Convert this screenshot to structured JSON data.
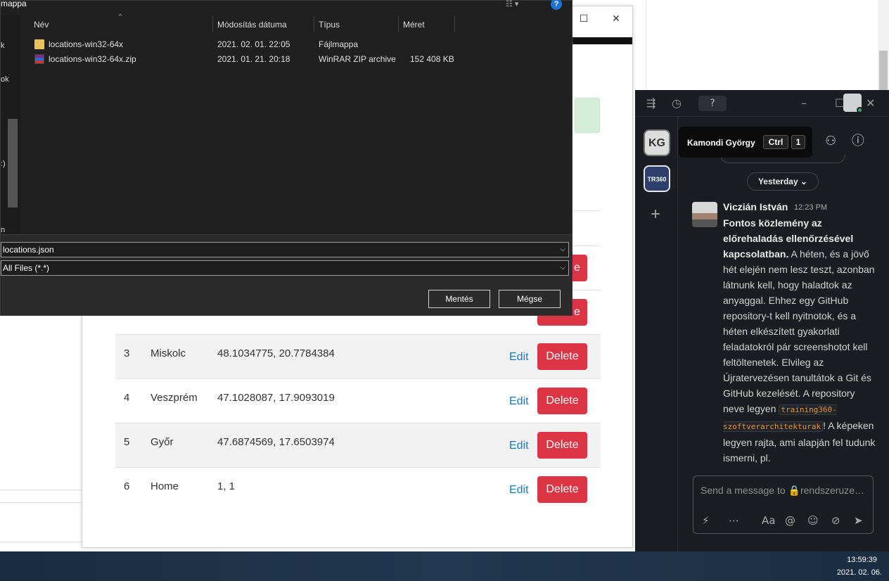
{
  "save_dialog": {
    "title_fragment": "mappa",
    "columns": [
      "Név",
      "Módosítás dátuma",
      "Típus",
      "Méret"
    ],
    "files": [
      {
        "name": "locations-win32-64x",
        "modified": "2021. 02. 01. 22:05",
        "type": "Fájlmappa",
        "size": "",
        "icon": "folder-icon"
      },
      {
        "name": "locations-win32-64x.zip",
        "modified": "2021. 01. 21. 20:18",
        "type": "WinRAR ZIP archive",
        "size": "152 408 KB",
        "icon": "zip-archive-icon"
      }
    ],
    "nav_fragments": [
      "k",
      "ok",
      ":)",
      "n"
    ],
    "filename_value": "locations.json",
    "filetype_value": "All Files (*.*)",
    "save_label": "Mentés",
    "cancel_label": "Mégse",
    "help_label": "?"
  },
  "web_app": {
    "rows": [
      {
        "id": "3",
        "name": "Miskolc",
        "coords": "48.1034775, 20.7784384"
      },
      {
        "id": "4",
        "name": "Veszprém",
        "coords": "47.1028087, 17.9093019"
      },
      {
        "id": "5",
        "name": "Győr",
        "coords": "47.6874569, 17.6503974"
      },
      {
        "id": "6",
        "name": "Home",
        "coords": "1, 1"
      }
    ],
    "edit_label": "Edit",
    "delete_label": "Delete",
    "delete_partial": "e",
    "delete_color": "#dc3545",
    "edit_color": "#1a7ac4"
  },
  "chat": {
    "workspaces": [
      {
        "initials": "KG"
      },
      {
        "initials": "TR360"
      }
    ],
    "add_workspace": "+",
    "tooltip": {
      "name": "Kamondi György",
      "key1": "Ctrl",
      "key2": "1"
    },
    "date_separator": "Yesterday",
    "message": {
      "author": "Viczián István",
      "time": "12:23 PM",
      "bold_intro": "Fontos közlemény az előrehaladás ellenőrzésével kapcsolatban.",
      "text1": " A héten, és a jövő hét elején nem lesz teszt, azonban látnunk kell, hogy haladtok az anyaggal. Ehhez egy GitHub repository-t kell nyitnotok, és a héten elkészített gyakorlati feladatokról pár screenshotot kell feltöltenetek. Elvileg az Újratervezésen tanultátok a Git és GitHub kezelését. A repository neve legyen ",
      "code": "training360-szoftverarchitekturak",
      "text2": "! A képeken legyen rajta, ami alapján fel tudunk ismerni, pl."
    },
    "composer_placeholder": "Send a message to 🔒rendszeruze…",
    "accent_green": "#2bac76"
  },
  "taskbar": {
    "time": "13:59:39",
    "date": "2021. 02. 06."
  }
}
